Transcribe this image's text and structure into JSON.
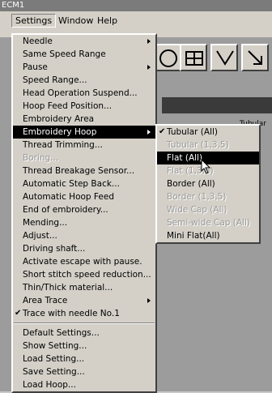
{
  "window": {
    "title": "ECM1"
  },
  "menubar": [
    {
      "label": "Settings"
    },
    {
      "label": "Window"
    },
    {
      "label": "Help"
    }
  ],
  "background": {
    "partial_text": "Tubular (All)"
  },
  "settings_menu": [
    {
      "label": "Needle",
      "submenu": true
    },
    {
      "label": "Same Speed Range"
    },
    {
      "label": "Pause",
      "submenu": true
    },
    {
      "label": "Speed Range..."
    },
    {
      "label": "Head Operation Suspend..."
    },
    {
      "label": "Hoop Feed Position..."
    },
    {
      "label": "Embroidery Area"
    },
    {
      "label": "Embroidery Hoop",
      "submenu": true,
      "selected": true
    },
    {
      "label": "Thread Trimming..."
    },
    {
      "label": "Boring...",
      "disabled": true
    },
    {
      "label": "Thread Breakage Sensor..."
    },
    {
      "label": "Automatic Step Back..."
    },
    {
      "label": "Automatic Hoop Feed"
    },
    {
      "label": "End of embroidery..."
    },
    {
      "label": "Mending..."
    },
    {
      "label": "Adjust..."
    },
    {
      "label": "Driving shaft..."
    },
    {
      "label": "Activate escape with pause."
    },
    {
      "label": "Short stitch speed reduction..."
    },
    {
      "label": "Thin/Thick material..."
    },
    {
      "label": "Area Trace",
      "submenu": true
    },
    {
      "label": "Trace with needle No.1",
      "checked": true
    },
    {
      "separator": true
    },
    {
      "label": "Default Settings..."
    },
    {
      "label": "Show Setting..."
    },
    {
      "label": "Load Setting..."
    },
    {
      "label": "Save Setting..."
    },
    {
      "label": "Load Hoop..."
    }
  ],
  "hoop_submenu": [
    {
      "label": "Tubular (All)",
      "checked": true
    },
    {
      "label": "Tubular (1,3,5)",
      "disabled": true
    },
    {
      "label": "Flat (All)",
      "selected": true
    },
    {
      "label": "Flat (1,3,5)",
      "disabled": true
    },
    {
      "label": "Border (All)"
    },
    {
      "label": "Border (1,3,5)",
      "disabled": true
    },
    {
      "label": "Wide Cap (All)",
      "disabled": true
    },
    {
      "label": "Semi-wide Cap (All)",
      "disabled": true
    },
    {
      "label": "Mini Flat(All)"
    }
  ]
}
